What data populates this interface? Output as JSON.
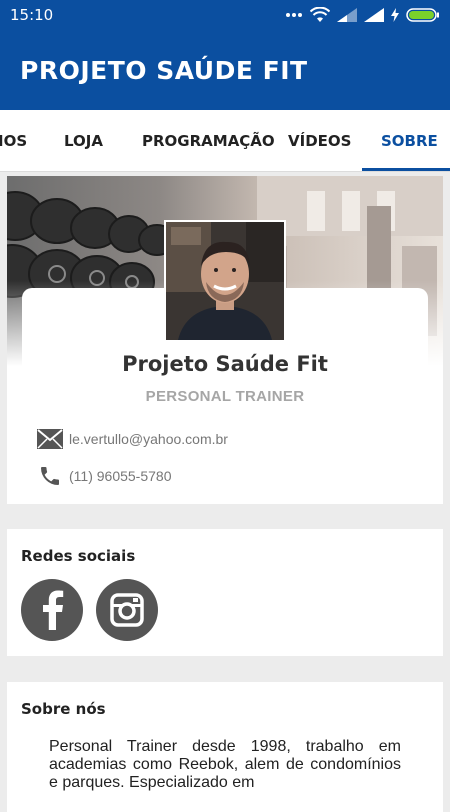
{
  "status_bar": {
    "time": "15:10",
    "icons": [
      "more-dots-icon",
      "wifi-icon",
      "signal-icon",
      "signal-icon",
      "charging-icon",
      "battery-icon"
    ]
  },
  "app_bar": {
    "title": "PROJETO SAÚDE FIT"
  },
  "tabs": [
    {
      "label": "IOS",
      "active": false
    },
    {
      "label": "LOJA",
      "active": false
    },
    {
      "label": "PROGRAMAÇÃO",
      "active": false
    },
    {
      "label": "VÍDEOS",
      "active": false
    },
    {
      "label": "SOBRE",
      "active": true
    }
  ],
  "profile": {
    "name": "Projeto Saúde Fit",
    "role": "PERSONAL TRAINER",
    "email": "le.vertullo@yahoo.com.br",
    "phone": "(11) 96055-5780"
  },
  "social": {
    "title": "Redes sociais",
    "networks": [
      "facebook-icon",
      "instagram-icon"
    ]
  },
  "about": {
    "title": "Sobre nós",
    "text": "Personal Trainer desde 1998, trabalho em academias como Reebok, alem de condomínios e parques. Especializado em"
  },
  "colors": {
    "brand": "#0b4fa0",
    "icon_gray": "#555555",
    "background": "#ececec"
  }
}
